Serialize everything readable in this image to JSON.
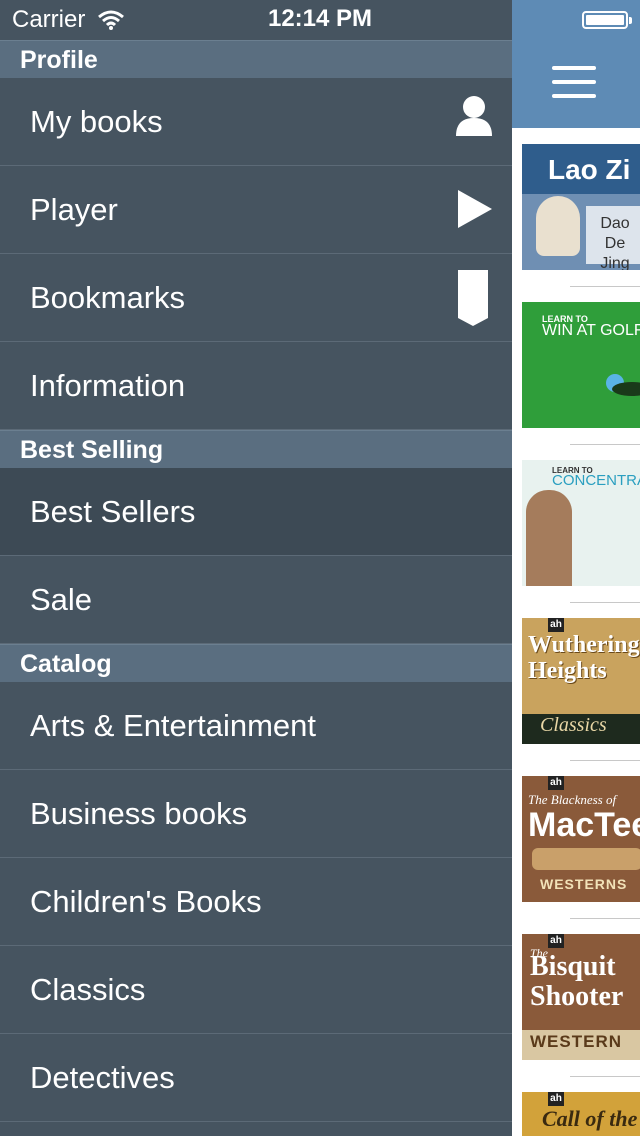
{
  "status": {
    "carrier": "Carrier",
    "time": "12:14 PM"
  },
  "sections": [
    {
      "header": "Profile",
      "items": [
        {
          "label": "My books",
          "icon": "person-icon"
        },
        {
          "label": "Player",
          "icon": "play-icon"
        },
        {
          "label": "Bookmarks",
          "icon": "bookmark-icon"
        },
        {
          "label": "Information",
          "icon": ""
        }
      ]
    },
    {
      "header": "Best Selling",
      "items": [
        {
          "label": "Best Sellers",
          "icon": ""
        },
        {
          "label": "Sale",
          "icon": ""
        }
      ]
    },
    {
      "header": "Catalog",
      "items": [
        {
          "label": "Arts & Entertainment",
          "icon": ""
        },
        {
          "label": "Business books",
          "icon": ""
        },
        {
          "label": "Children's Books",
          "icon": ""
        },
        {
          "label": "Classics",
          "icon": ""
        },
        {
          "label": "Detectives",
          "icon": ""
        }
      ]
    }
  ],
  "books": [
    {
      "title": "Lao Zi",
      "subtitle": "Dao De Jing"
    },
    {
      "title": "WIN AT GOLF",
      "prefix": "LEARN TO"
    },
    {
      "title": "CONCENTRATE",
      "prefix": "LEARN TO"
    },
    {
      "title": "Wuthering Heights",
      "series": "Classics",
      "badge": "ah"
    },
    {
      "title": "MacTee",
      "prefix": "The Blackness of",
      "series": "WESTERNS",
      "badge": "ah"
    },
    {
      "title": "Bisquit Shooter",
      "prefix": "The",
      "series": "WESTERN",
      "badge": "ah"
    },
    {
      "title": "Call of the",
      "badge": "ah"
    }
  ]
}
